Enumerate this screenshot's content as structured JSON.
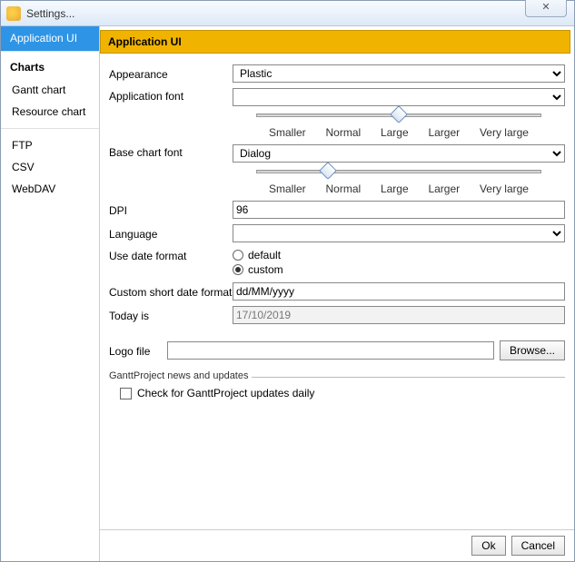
{
  "window": {
    "title": "Settings..."
  },
  "close": "✕",
  "sidebar": {
    "top": {
      "appui": "Application UI"
    },
    "charts_title": "Charts",
    "charts": {
      "gantt": "Gantt chart",
      "resource": "Resource chart"
    },
    "export": {
      "ftp": "FTP",
      "csv": "CSV",
      "webdav": "WebDAV"
    }
  },
  "header": "Application UI",
  "labels": {
    "appearance": "Appearance",
    "app_font": "Application font",
    "base_font": "Base chart font",
    "dpi": "DPI",
    "language": "Language",
    "use_date_format": "Use date format",
    "custom_short": "Custom short date format",
    "today_is": "Today is",
    "logo": "Logo file"
  },
  "values": {
    "appearance": "Plastic",
    "app_font": "",
    "base_font": "Dialog",
    "dpi": "96",
    "language": "",
    "custom_short": "dd/MM/yyyy",
    "today_is": "17/10/2019",
    "logo": ""
  },
  "ticks": {
    "t0": "Smaller",
    "t1": "Normal",
    "t2": "Large",
    "t3": "Larger",
    "t4": "Very large"
  },
  "radios": {
    "default": "default",
    "custom": "custom"
  },
  "buttons": {
    "browse": "Browse...",
    "ok": "Ok",
    "cancel": "Cancel"
  },
  "fieldset": {
    "legend": "GanttProject news and updates",
    "check": "Check for GanttProject updates daily"
  },
  "slider_positions": {
    "app_font_pct": 50,
    "base_font_pct": 25
  }
}
